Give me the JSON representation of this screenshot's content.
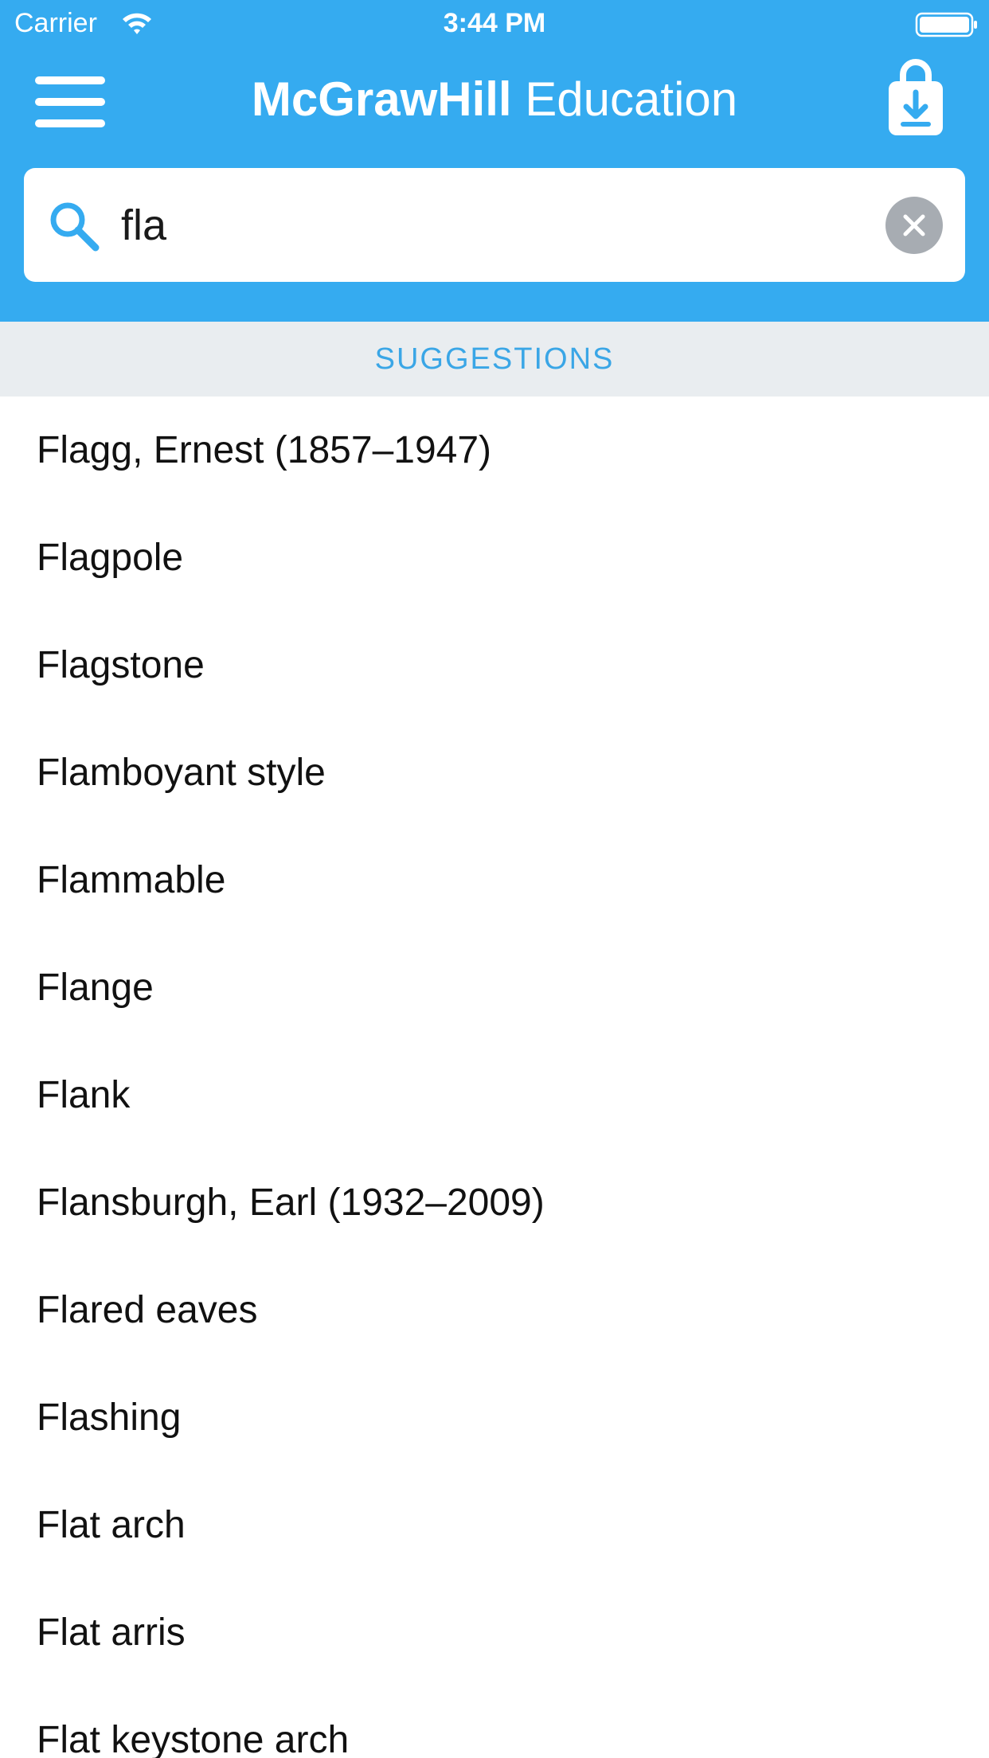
{
  "status_bar": {
    "carrier": "Carrier",
    "time": "3:44 PM"
  },
  "nav_bar": {
    "brand_strong": "McGrawHill",
    "brand_light": "Education",
    "menu_icon": "hamburger-menu-icon",
    "download_icon": "shopping-bag-download-icon"
  },
  "search": {
    "value": "fla",
    "icon": "search-icon",
    "clear_icon": "clear-circle-x-icon"
  },
  "suggestions": {
    "header": "SUGGESTIONS",
    "items": [
      "Flagg, Ernest (1857–1947)",
      "Flagpole",
      "Flagstone",
      "Flamboyant style",
      "Flammable",
      "Flange",
      "Flank",
      "Flansburgh, Earl (1932–2009)",
      "Flared eaves",
      "Flashing",
      "Flat arch",
      "Flat arris",
      "Flat keystone arch"
    ]
  },
  "colors": {
    "header_bg": "#35abf0",
    "section_bg": "#e9edf0",
    "section_text": "#3aa6e6"
  }
}
